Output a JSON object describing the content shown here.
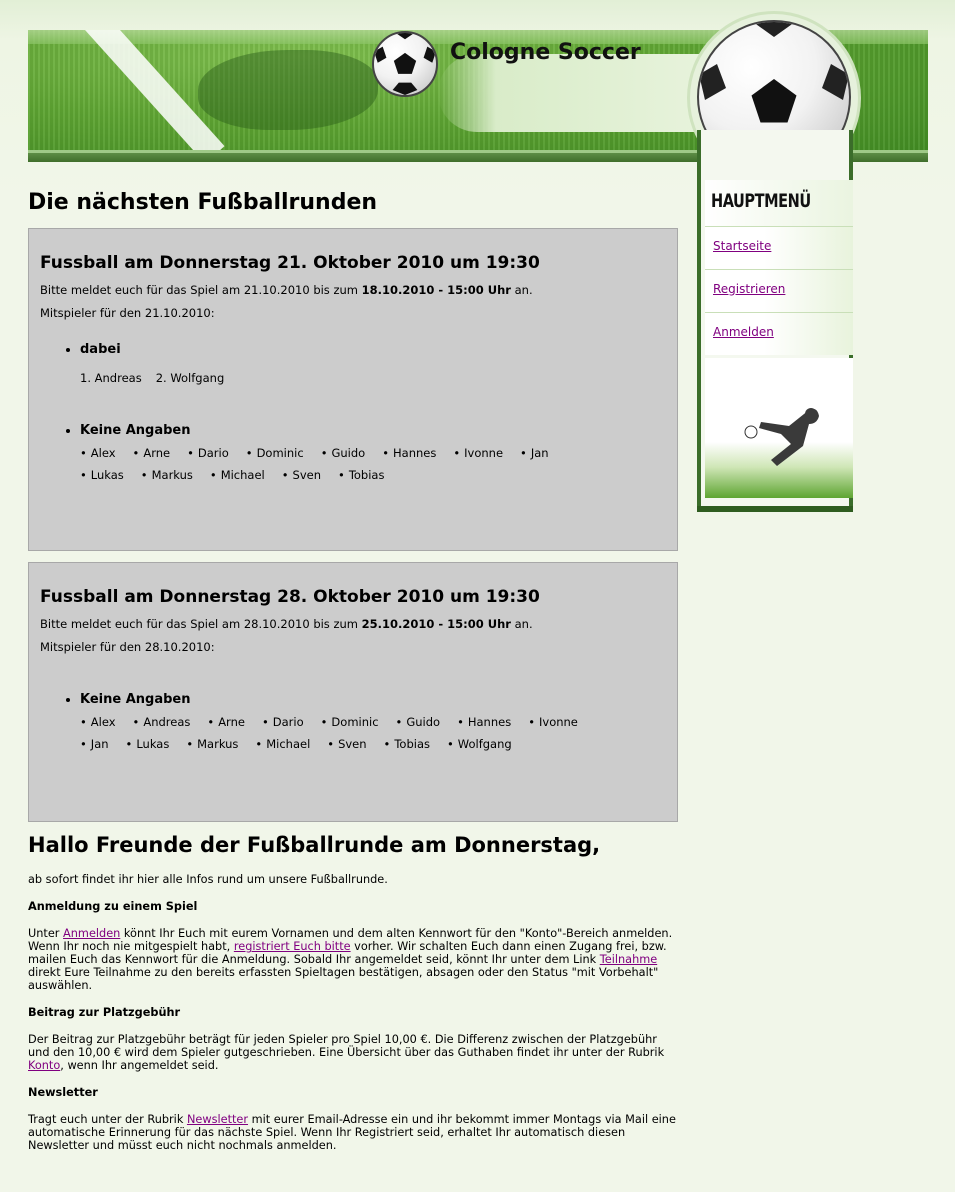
{
  "header": {
    "title": "Cologne Soccer"
  },
  "sidebar": {
    "title": "HAUPTMENÜ",
    "items": [
      {
        "label": "Startseite"
      },
      {
        "label": "Registrieren"
      },
      {
        "label": "Anmelden"
      }
    ]
  },
  "main": {
    "heading": "Die nächsten Fußballrunden",
    "games": [
      {
        "title": "Fussball am Donnerstag 21. Oktober 2010 um 19:30",
        "note_pre": "Bitte meldet euch für das Spiel am 21.10.2010 bis zum ",
        "note_deadline": "18.10.2010 - 15:00 Uhr",
        "note_post": " an.",
        "players_label": "Mitspieler für den 21.10.2010:",
        "dabei_label": "dabei",
        "dabei": [
          "Andreas",
          "Wolfgang"
        ],
        "keine_label": "Keine Angaben",
        "keine": [
          "Alex",
          "Arne",
          "Dario",
          "Dominic",
          "Guido",
          "Hannes",
          "Ivonne",
          "Jan",
          "Lukas",
          "Markus",
          "Michael",
          "Sven",
          "Tobias"
        ]
      },
      {
        "title": "Fussball am Donnerstag 28. Oktober 2010 um 19:30",
        "note_pre": "Bitte meldet euch für das Spiel am 28.10.2010 bis zum ",
        "note_deadline": "25.10.2010 - 15:00 Uhr",
        "note_post": " an.",
        "players_label": "Mitspieler für den 28.10.2010:",
        "keine_label": "Keine Angaben",
        "keine": [
          "Alex",
          "Andreas",
          "Arne",
          "Dario",
          "Dominic",
          "Guido",
          "Hannes",
          "Ivonne",
          "Jan",
          "Lukas",
          "Markus",
          "Michael",
          "Sven",
          "Tobias",
          "Wolfgang"
        ]
      }
    ],
    "welcome": {
      "heading": "Hallo Freunde der Fußballrunde am Donnerstag,",
      "intro": "ab sofort findet ihr hier alle Infos rund um unsere Fußballrunde.",
      "s1_head": "Anmeldung zu einem Spiel",
      "s1_a": "Unter ",
      "s1_link1": "Anmelden",
      "s1_b": " könnt Ihr Euch mit eurem Vornamen und dem alten Kennwort für den \"Konto\"-Bereich anmelden. Wenn Ihr noch nie mitgespielt habt, ",
      "s1_link2": "registriert Euch bitte",
      "s1_c": " vorher. Wir schalten Euch dann einen Zugang frei, bzw. mailen Euch das Kennwort für die Anmeldung. Sobald Ihr angemeldet seid, könnt Ihr unter dem Link ",
      "s1_link3": "Teilnahme",
      "s1_d": " direkt Eure Teilnahme zu den bereits erfassten Spieltagen bestätigen, absagen oder den Status \"mit Vorbehalt\" auswählen.",
      "s2_head": "Beitrag zur Platzgebühr",
      "s2_a": "Der Beitrag zur Platzgebühr beträgt für jeden Spieler pro Spiel 10,00 €.  Die Differenz zwischen der Platzgebühr und den 10,00 € wird dem Spieler gutgeschrieben. Eine Übersicht über das Guthaben findet ihr unter der Rubrik ",
      "s2_link": "Konto",
      "s2_b": ", wenn Ihr angemeldet seid.",
      "s3_head": "Newsletter",
      "s3_a": "Tragt euch unter der Rubrik ",
      "s3_link": "Newsletter",
      "s3_b": " mit eurer Email-Adresse ein und ihr bekommt immer Montags via Mail eine automatische Erinnerung für das nächste Spiel. Wenn Ihr Registriert seid, erhaltet Ihr automatisch diesen Newsletter und müsst euch nicht nochmals anmelden."
    }
  }
}
